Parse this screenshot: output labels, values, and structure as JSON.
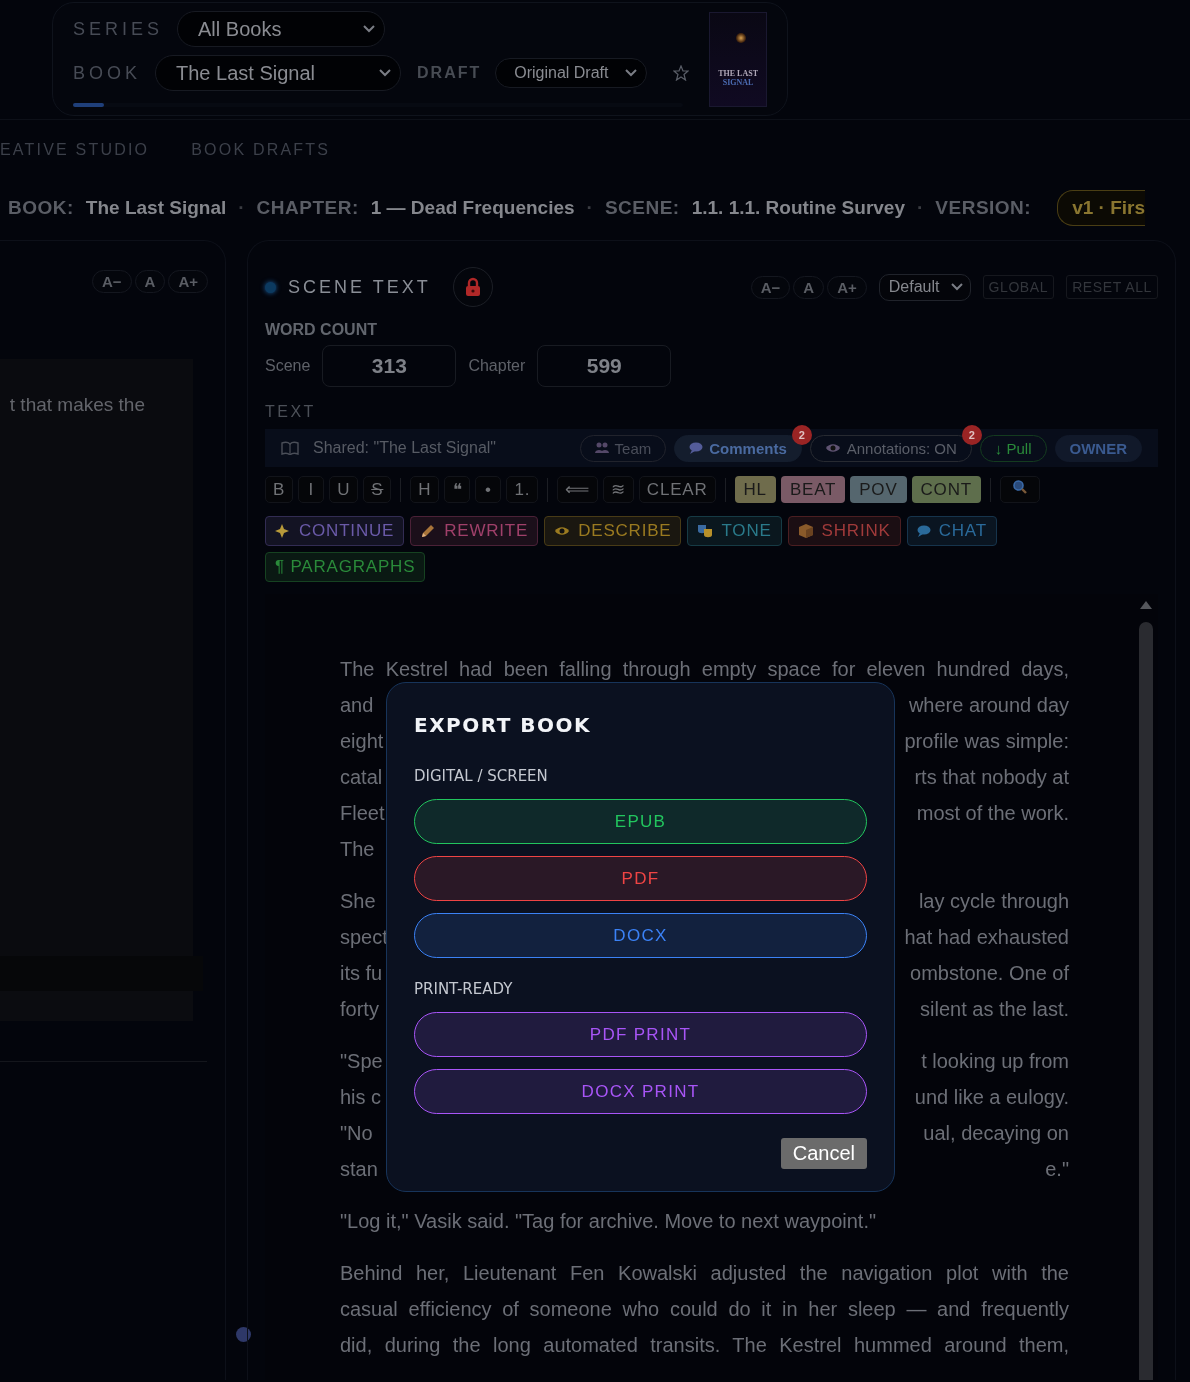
{
  "header": {
    "series_label": "SERIES",
    "series": "All Books",
    "book_label": "BOOK",
    "book": "The Last Signal",
    "draft_label": "DRAFT",
    "draft": "Original Draft",
    "starred": false,
    "level": 0.05,
    "cover": {
      "title_line_1": "THE LAST",
      "title_line_2": "SIGNAL"
    }
  },
  "tabs": [
    {
      "label": "EATIVE STUDIO",
      "selected": false
    },
    {
      "label": "BOOK DRAFTS",
      "selected": false
    }
  ],
  "breadcrumb": [
    {
      "label": "BOOK:",
      "value": "The Last Signal"
    },
    {
      "separator": "·",
      "label": "CHAPTER:",
      "value": "1 — Dead Frequencies"
    },
    {
      "separator": "·",
      "label": "SCENE:",
      "value": "1.1. 1.1. Routine Survey"
    }
  ],
  "version": {
    "separator": "·",
    "label": "VERSION:",
    "badge": "v1 · Firs"
  },
  "left_panel": {
    "font_buttons": [
      "A−",
      "A",
      "A+"
    ],
    "text": "t that makes the"
  },
  "scene": {
    "title": "SCENE TEXT",
    "locked": true,
    "font_buttons": [
      "A−",
      "A",
      "A+"
    ],
    "font_select": "Default",
    "buttons": [
      "GLOBAL",
      "RESET ALL"
    ],
    "word_count": {
      "label": "WORD COUNT",
      "scene_label": "Scene",
      "scene": "313",
      "chapter_label": "Chapter",
      "chapter": "599"
    },
    "text_label": "TEXT",
    "shared": "Shared: \"The Last Signal\"",
    "share_items": [
      {
        "label": "Team",
        "kind": "team",
        "color": "#4a4e5a"
      },
      {
        "label": "Comments",
        "kind": "comments",
        "color": "#4a6aa0",
        "badge": "2"
      },
      {
        "label": "Annotations: ON",
        "kind": "annotations",
        "color": "#5a5e68",
        "badge": "2"
      },
      {
        "label": "↓ Pull",
        "kind": "pull",
        "color": "#2a8a3a"
      },
      {
        "label": "OWNER",
        "kind": "owner",
        "color": "#3a5a90"
      }
    ],
    "format_groups": [
      [
        {
          "label": "B",
          "kind": "plain"
        },
        {
          "label": "I",
          "kind": "plain"
        },
        {
          "label": "U",
          "kind": "plain"
        },
        {
          "label": "S",
          "kind": "strike"
        }
      ],
      [
        {
          "label": "H",
          "kind": "plain"
        },
        {
          "label": "❝",
          "kind": "plain"
        },
        {
          "label": "•",
          "kind": "plain"
        },
        {
          "label": "1.",
          "kind": "plain"
        }
      ],
      [
        {
          "label": "⟸",
          "kind": "plain"
        },
        {
          "label": "≋",
          "kind": "plain"
        },
        {
          "label": "CLEAR",
          "kind": "plain"
        }
      ]
    ],
    "tags": [
      {
        "label": "HL",
        "color": "#6f6c4c"
      },
      {
        "label": "BEAT",
        "color": "#7a5a66"
      },
      {
        "label": "POV",
        "color": "#55666e"
      },
      {
        "label": "CONT",
        "color": "#5e6e4c"
      }
    ],
    "ai_buttons": [
      {
        "label": "CONTINUE",
        "kind": "continue",
        "color": "#6a5aa8"
      },
      {
        "label": "REWRITE",
        "kind": "rewrite",
        "color": "#a0406a"
      },
      {
        "label": "DESCRIBE",
        "kind": "describe",
        "color": "#9a7a20"
      },
      {
        "label": "TONE",
        "kind": "tone",
        "color": "#2a7a8a"
      },
      {
        "label": "SHRINK",
        "kind": "shrink",
        "color": "#a03a3a"
      },
      {
        "label": "CHAT",
        "kind": "chat",
        "color": "#2a6a9a"
      },
      {
        "label": "¶ PARAGRAPHS",
        "kind": "paragraphs",
        "color": "#2a8a3a"
      }
    ],
    "paragraphs": [
      [
        {
          "kind": "justified",
          "text": "The Kestrel had been falling through empty space for eleven hundred days,"
        },
        {
          "kind": "split",
          "left": "and",
          "right": "where around day"
        },
        {
          "kind": "split",
          "left": "eight",
          "right": "profile was simple:"
        },
        {
          "kind": "split",
          "left": "catal",
          "right": "rts that nobody at"
        },
        {
          "kind": "split",
          "left": "Fleet",
          "right": "most of the work."
        },
        {
          "kind": "split",
          "left": "The"
        }
      ],
      [
        {
          "kind": "split",
          "left": "She",
          "right": "lay cycle through"
        },
        {
          "kind": "split",
          "left": "spect",
          "right": "hat had exhausted"
        },
        {
          "kind": "split",
          "left": "its fu",
          "right": "ombstone. One of"
        },
        {
          "kind": "split",
          "left": "forty",
          "right": "silent as the last."
        }
      ],
      [
        {
          "kind": "split",
          "left": "\"Spe",
          "right": "t looking up from"
        },
        {
          "kind": "split",
          "left": "his c",
          "right": "und like a eulogy."
        },
        {
          "kind": "split",
          "left": "\"No",
          "right": "ual, decaying on"
        },
        {
          "kind": "split",
          "left": "stan",
          "right": "e.\""
        }
      ],
      [
        {
          "kind": "last",
          "text": "\"Log it,\" Vasik said. \"Tag for archive. Move to next waypoint.\""
        }
      ],
      [
        {
          "kind": "justified",
          "text": "Behind her, Lieutenant Fen Kowalski adjusted the navigation plot with the"
        },
        {
          "kind": "justified",
          "text": "casual efficiency of someone who could do it in her sleep — and frequently"
        },
        {
          "kind": "justified",
          "text": "did, during the long automated transits. The Kestrel hummed around them,"
        }
      ]
    ]
  },
  "dialog": {
    "title": "EXPORT BOOK",
    "sections": [
      {
        "label": "DIGITAL / SCREEN",
        "buttons": [
          {
            "label": "EPUB",
            "color": "#22c55e"
          },
          {
            "label": "PDF",
            "color": "#ef4444"
          },
          {
            "label": "DOCX",
            "color": "#3b82f6"
          }
        ]
      },
      {
        "label": "PRINT-READY",
        "buttons": [
          {
            "label": "PDF PRINT",
            "color": "#a855f7"
          },
          {
            "label": "DOCX PRINT",
            "color": "#a855f7"
          }
        ]
      }
    ],
    "cancel": "Cancel"
  }
}
